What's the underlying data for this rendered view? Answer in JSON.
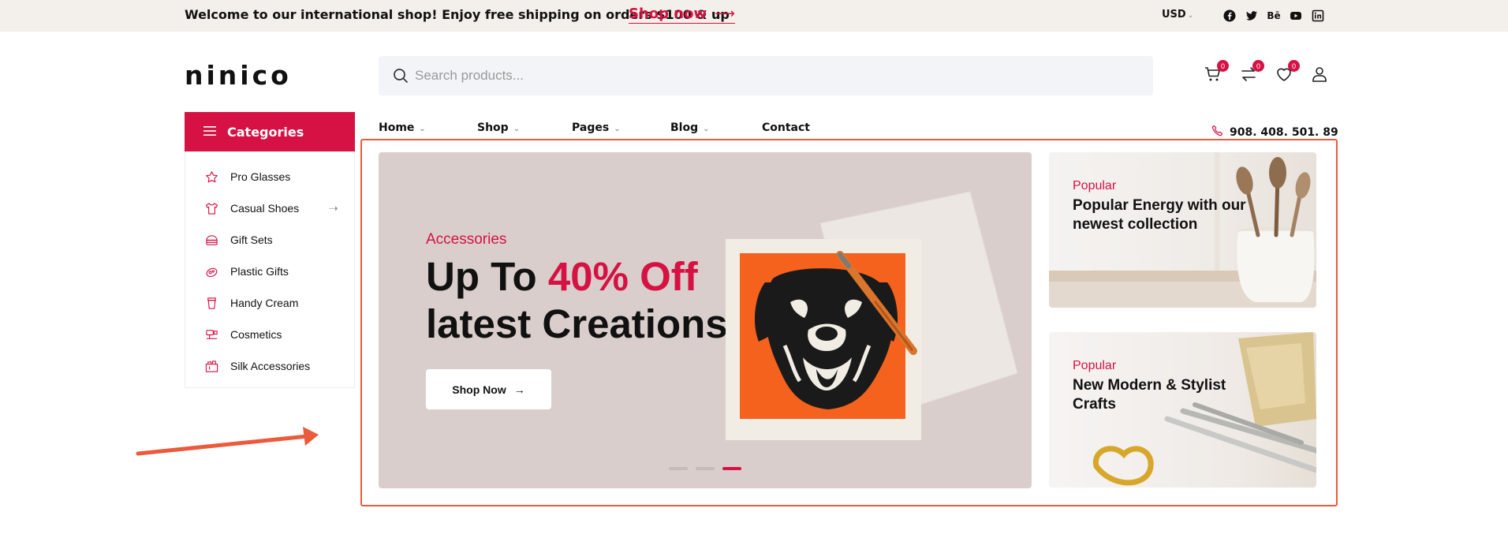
{
  "topbar": {
    "welcome": "Welcome to our international shop! Enjoy free shipping on orders $100 & up",
    "shop_now": "Shop now",
    "currency": "USD",
    "socials": [
      "facebook-icon",
      "twitter-icon",
      "behance-icon",
      "youtube-icon",
      "linkedin-icon"
    ],
    "behance_text": "Bē"
  },
  "header": {
    "logo": "ninico",
    "search_placeholder": "Search products...",
    "cart_count": "0",
    "compare_count": "0",
    "wishlist_count": "0"
  },
  "categories": {
    "title": "Categories",
    "items": [
      {
        "label": "Pro Glasses",
        "icon": "star-icon"
      },
      {
        "label": "Casual Shoes",
        "icon": "shirt-icon",
        "has_submenu": true
      },
      {
        "label": "Gift Sets",
        "icon": "gift-box-icon"
      },
      {
        "label": "Plastic Gifts",
        "icon": "soap-icon"
      },
      {
        "label": "Handy Cream",
        "icon": "cream-jar-icon"
      },
      {
        "label": "Cosmetics",
        "icon": "cosmetics-icon"
      },
      {
        "label": "Silk Accessories",
        "icon": "silk-accessories-icon"
      }
    ]
  },
  "nav": {
    "items": [
      {
        "label": "Home",
        "dropdown": true
      },
      {
        "label": "Shop",
        "dropdown": true
      },
      {
        "label": "Pages",
        "dropdown": true
      },
      {
        "label": "Blog",
        "dropdown": true
      },
      {
        "label": "Contact",
        "dropdown": false
      }
    ],
    "phone": "908. 408. 501. 89"
  },
  "hero": {
    "category": "Accessories",
    "headline_part1": "Up To ",
    "headline_highlight": "40% Off",
    "headline_line2": "latest Creations",
    "button": "Shop Now",
    "slides_total": 3,
    "active_slide": 3
  },
  "side_cards": [
    {
      "kicker": "Popular",
      "title": "Popular Energy with our newest collection"
    },
    {
      "kicker": "Popular",
      "title": "New Modern & Stylist Crafts"
    }
  ],
  "colors": {
    "accent": "#d51243",
    "topbar_bg": "#f3efea",
    "hero_bg": "#d9cecb",
    "annotation": "#ec5a3c"
  }
}
